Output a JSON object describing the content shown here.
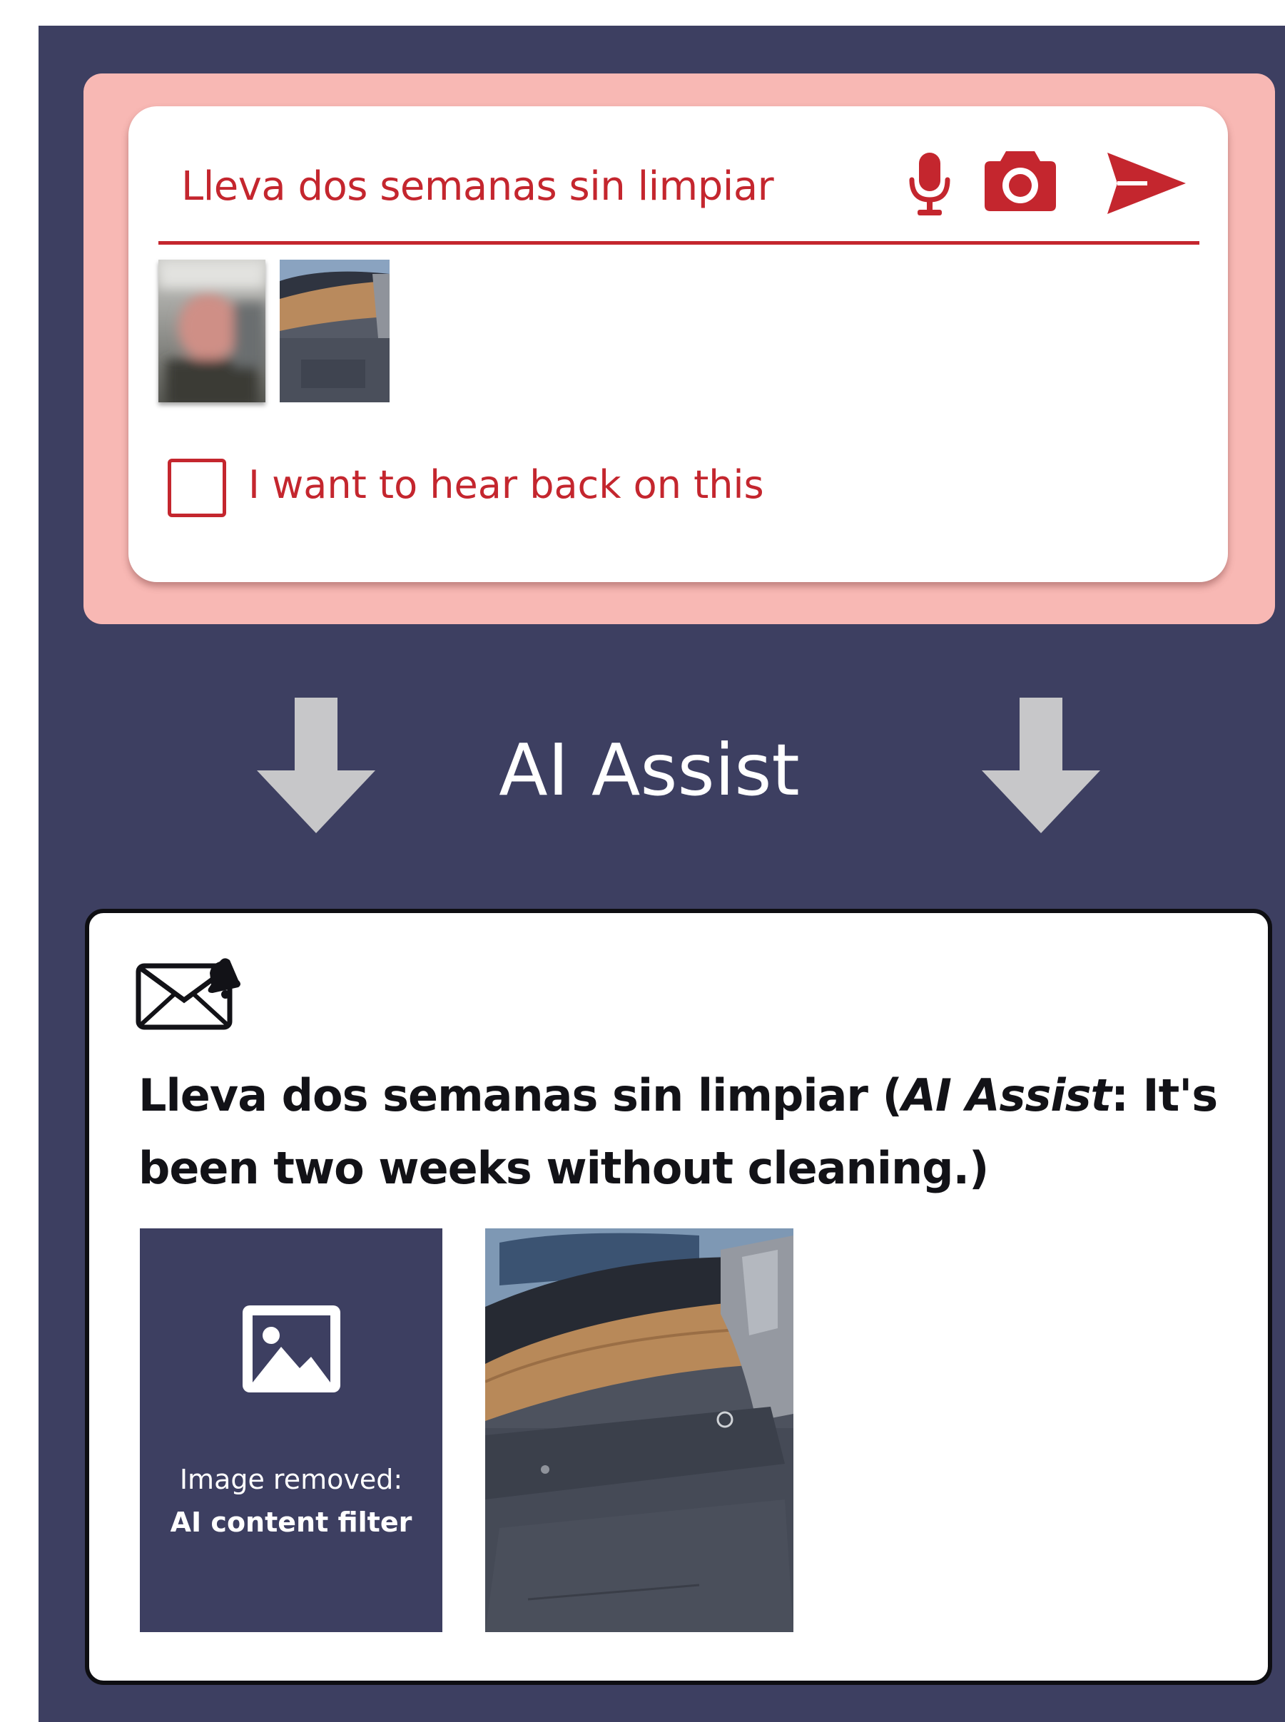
{
  "colors": {
    "frame_background": "#3d3f61",
    "input_panel_background": "#f8b8b4",
    "accent_red": "#c4262e",
    "arrow_gray": "#c7c7c9",
    "text_dark": "#121217"
  },
  "input_panel": {
    "message_text": "Lleva dos semanas sin limpiar",
    "icons": [
      "microphone-icon",
      "camera-icon",
      "send-icon"
    ],
    "attachments": [
      "blurred-person-photo",
      "paper-towel-dispenser-photo"
    ],
    "checkbox_label": "I want to hear back on this",
    "checkbox_checked": false
  },
  "divider": {
    "title": "AI Assist",
    "icons": [
      "arrow-down-icon",
      "arrow-down-icon"
    ]
  },
  "output_card": {
    "icon": "envelope-bell-icon",
    "message_original": "Lleva dos semanas sin limpiar (",
    "ai_label": "AI Assist",
    "translation": ": It's been two weeks without cleaning.)",
    "removed_image": {
      "icon": "image-icon",
      "caption_line1": "Image removed:",
      "caption_line2": "AI content filter"
    },
    "photo": "paper-towel-dispenser-photo"
  }
}
